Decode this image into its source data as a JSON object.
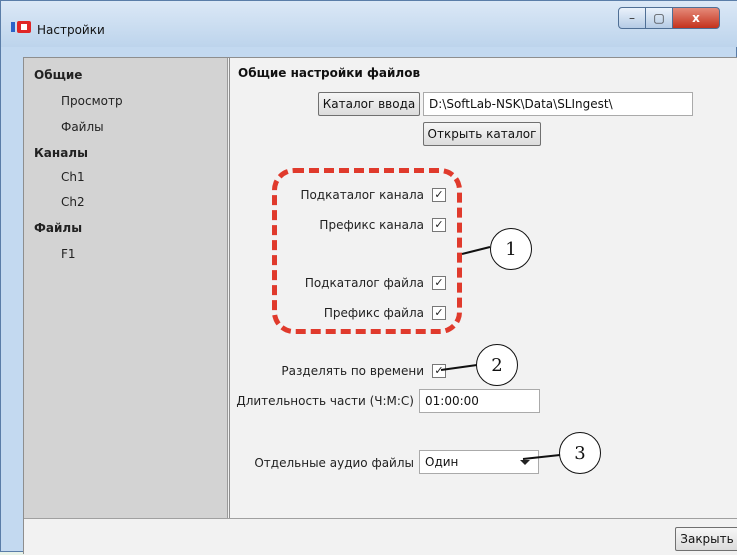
{
  "window": {
    "title": "Настройки"
  },
  "title_controls": {
    "minimize": "–",
    "maximize": "▢",
    "close": "x"
  },
  "sidebar": {
    "items": [
      {
        "label": "Общие",
        "type": "header"
      },
      {
        "label": "Просмотр",
        "type": "sub"
      },
      {
        "label": "Файлы",
        "type": "sub"
      },
      {
        "label": "Каналы",
        "type": "header"
      },
      {
        "label": "Ch1",
        "type": "sub"
      },
      {
        "label": "Ch2",
        "type": "sub"
      },
      {
        "label": "Файлы",
        "type": "header"
      },
      {
        "label": "F1",
        "type": "sub"
      }
    ]
  },
  "panel": {
    "section_title": "Общие настройки файлов",
    "input_catalog_button": "Каталог ввода",
    "input_catalog_path": "D:\\SoftLab-NSK\\Data\\SLIngest\\",
    "open_catalog_button": "Открыть каталог",
    "options": {
      "channel_subdir": {
        "label": "Подкаталог канала",
        "checked": "✓"
      },
      "channel_prefix": {
        "label": "Префикс канала",
        "checked": "✓"
      },
      "file_subdir": {
        "label": "Подкаталог файла",
        "checked": "✓"
      },
      "file_prefix": {
        "label": "Префикс файла",
        "checked": "✓"
      },
      "split_by_time": {
        "label": "Разделять по времени",
        "checked": "✓"
      }
    },
    "part_duration": {
      "label": "Длительность части (Ч:М:С)",
      "value": "01:00:00"
    },
    "separate_audio": {
      "label": "Отдельные аудио файлы",
      "selected": "Один"
    }
  },
  "footer": {
    "close_button": "Закрыть"
  },
  "callouts": [
    "1",
    "2",
    "3"
  ],
  "colors": {
    "annotation_dash": "#e03a2c",
    "window_frame": "#c3d9f0",
    "close_button": "#c4321d"
  }
}
